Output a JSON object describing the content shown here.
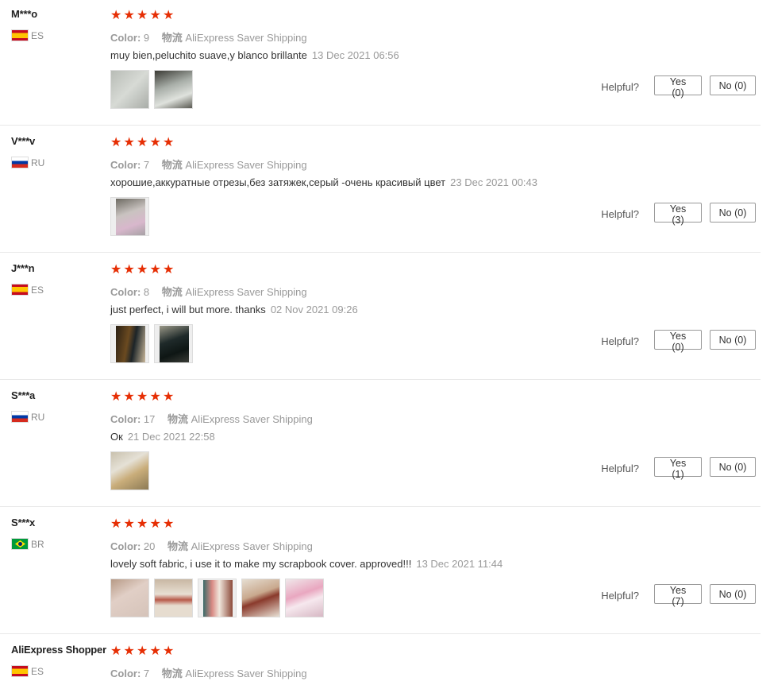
{
  "labels": {
    "color": "Color:",
    "shipping_key": "物流",
    "helpful": "Helpful?"
  },
  "star_color": "#e62e04",
  "reviews": [
    {
      "user": "M***o",
      "country": "ES",
      "flag": "es",
      "rating": 5,
      "color": "9",
      "shipping": "AliExpress Saver Shipping",
      "text": "muy bien,peluchito suave,y blanco brillante",
      "date": "13 Dec 2021 06:56",
      "photos": 2,
      "yes": "Yes (0)",
      "no": "No (0)"
    },
    {
      "user": "V***v",
      "country": "RU",
      "flag": "ru",
      "rating": 5,
      "color": "7",
      "shipping": "AliExpress Saver Shipping",
      "text": "хорошие,аккуратные отрезы,без затяжек,серый -очень красивый цвет",
      "date": "23 Dec 2021 00:43",
      "photos": 1,
      "yes": "Yes (3)",
      "no": "No (0)"
    },
    {
      "user": "J***n",
      "country": "ES",
      "flag": "es",
      "rating": 5,
      "color": "8",
      "shipping": "AliExpress Saver Shipping",
      "text": "just perfect, i will but more. thanks",
      "date": "02 Nov 2021 09:26",
      "photos": 2,
      "yes": "Yes (0)",
      "no": "No (0)"
    },
    {
      "user": "S***a",
      "country": "RU",
      "flag": "ru",
      "rating": 5,
      "color": "17",
      "shipping": "AliExpress Saver Shipping",
      "text": "Ок",
      "date": "21 Dec 2021 22:58",
      "photos": 1,
      "yes": "Yes (1)",
      "no": "No (0)"
    },
    {
      "user": "S***x",
      "country": "BR",
      "flag": "br",
      "rating": 5,
      "color": "20",
      "shipping": "AliExpress Saver Shipping",
      "text": "lovely soft fabric, i use it to make my scrapbook cover. approved!!!",
      "date": "13 Dec 2021 11:44",
      "photos": 5,
      "yes": "Yes (7)",
      "no": "No (0)"
    },
    {
      "user": "AliExpress Shopper",
      "country": "ES",
      "flag": "es",
      "rating": 5,
      "color": "7",
      "shipping": "AliExpress Saver Shipping",
      "text": "",
      "date": "",
      "photos": 0,
      "yes": "",
      "no": ""
    }
  ]
}
